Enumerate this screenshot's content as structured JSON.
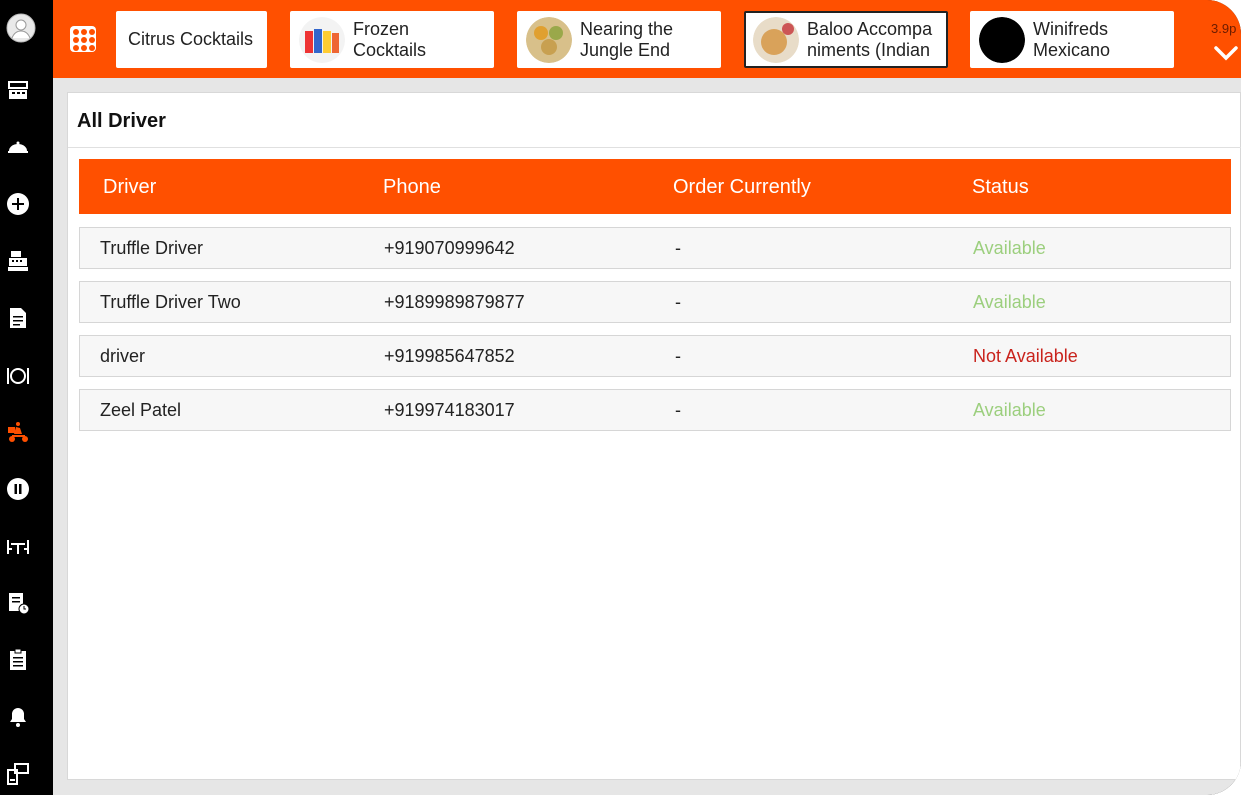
{
  "sidebar": {
    "items": [
      {
        "name": "profile-icon"
      },
      {
        "name": "pos-terminal-icon"
      },
      {
        "name": "food-tray-icon"
      },
      {
        "name": "add-circle-icon"
      },
      {
        "name": "cash-register-icon"
      },
      {
        "name": "document-icon"
      },
      {
        "name": "plate-cutlery-icon"
      },
      {
        "name": "delivery-scooter-icon"
      },
      {
        "name": "pause-circle-icon"
      },
      {
        "name": "table-chairs-icon"
      },
      {
        "name": "report-clock-icon"
      },
      {
        "name": "clipboard-list-icon"
      },
      {
        "name": "bell-icon"
      },
      {
        "name": "kiosk-icon"
      }
    ],
    "active_color": "#ff5000"
  },
  "topbar": {
    "categories": [
      {
        "label": "Citrus Cocktails"
      },
      {
        "label": "Frozen\nCocktails"
      },
      {
        "label": "Nearing the\nJungle End"
      },
      {
        "label": "Baloo Accompa\nniments (Indian"
      },
      {
        "label": "Winifreds\nMexicano"
      }
    ],
    "partial_text": "3.9p"
  },
  "page": {
    "title": "All Driver",
    "columns": [
      "Driver",
      "Phone",
      "Order Currently",
      "Status"
    ],
    "rows": [
      {
        "driver": "Truffle Driver",
        "phone": "+919070999642",
        "order": "-",
        "status": "Available"
      },
      {
        "driver": "Truffle Driver Two",
        "phone": "+9189989879877",
        "order": "-",
        "status": "Available"
      },
      {
        "driver": "driver",
        "phone": "+919985647852",
        "order": "-",
        "status": "Not Available"
      },
      {
        "driver": "Zeel Patel",
        "phone": "+919974183017",
        "order": "-",
        "status": "Available"
      }
    ]
  },
  "colors": {
    "accent": "#ff5000",
    "available": "#9ccf7e",
    "not_available": "#c9231c"
  }
}
